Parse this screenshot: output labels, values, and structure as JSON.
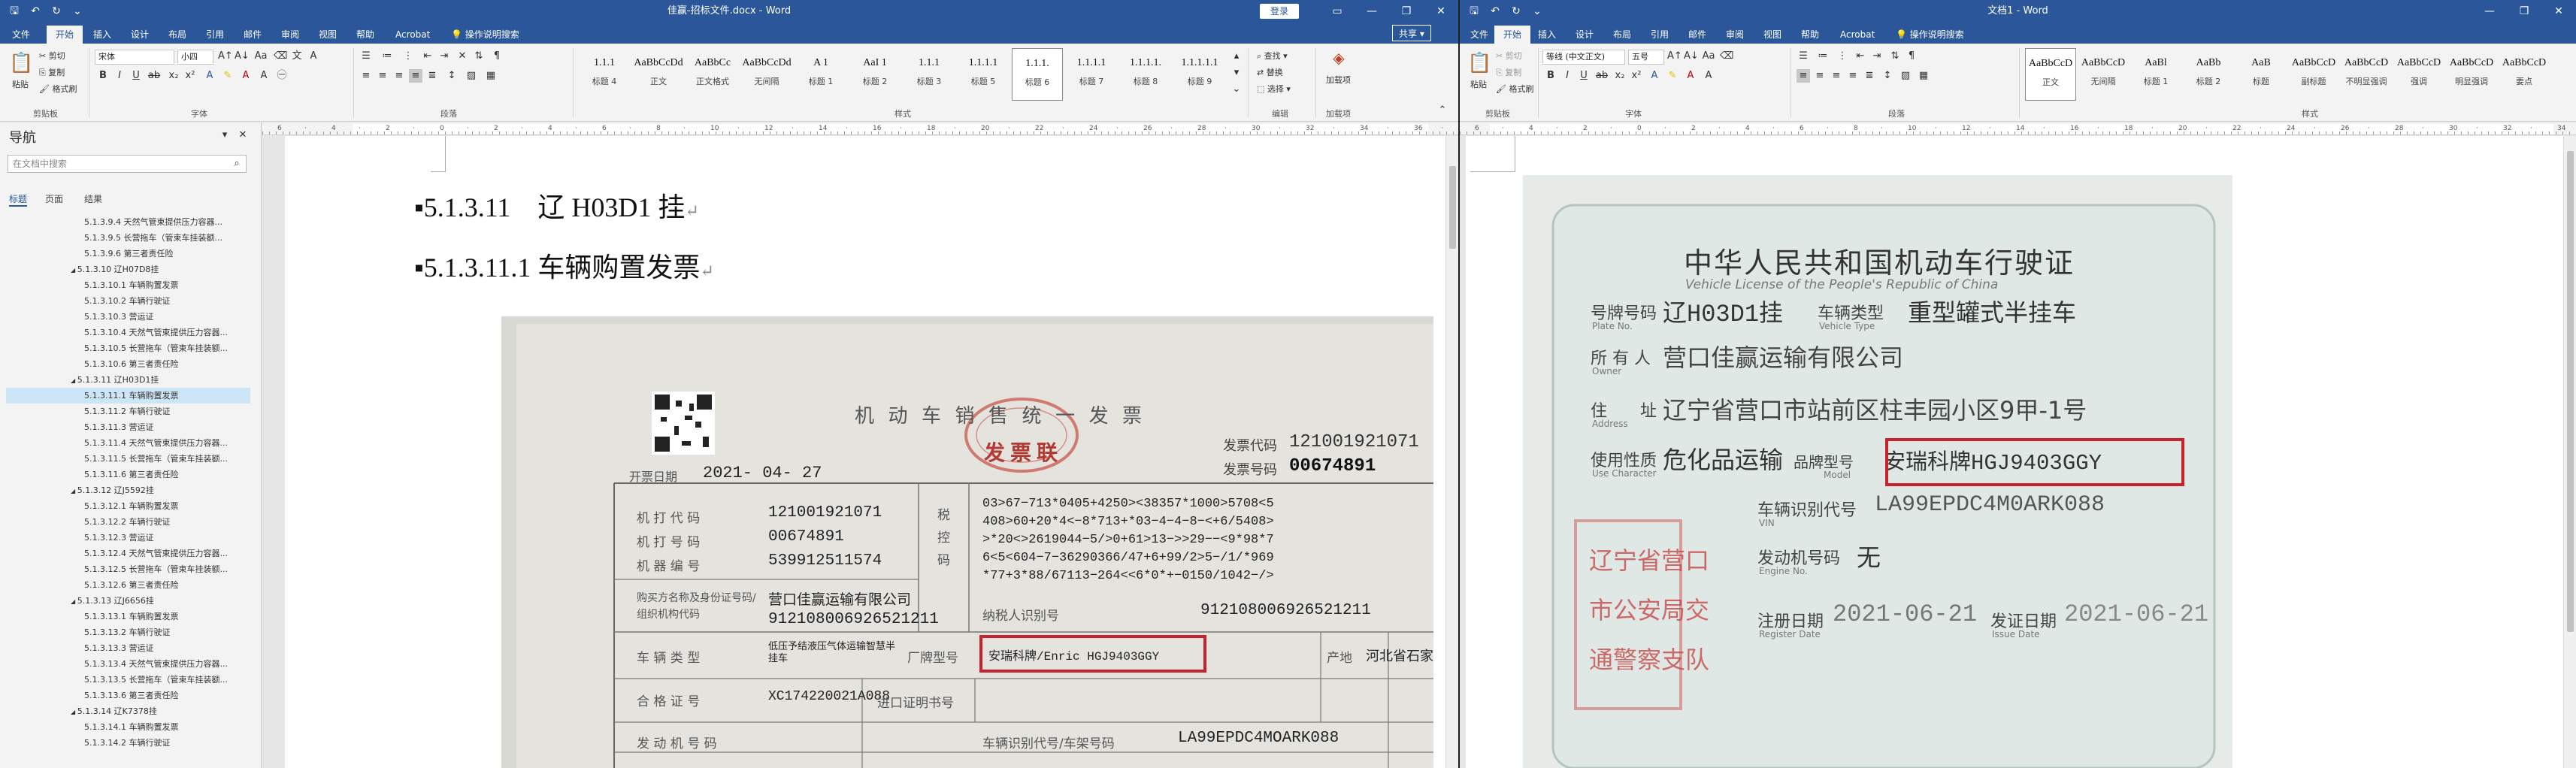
{
  "left": {
    "title": "佳赢-招标文件.docx - Word",
    "login_label": "登录",
    "share_label": "共享",
    "tabs": [
      "文件",
      "开始",
      "插入",
      "设计",
      "布局",
      "引用",
      "邮件",
      "审阅",
      "视图",
      "帮助",
      "Acrobat"
    ],
    "tell_me": "操作说明搜索",
    "clipboard": {
      "paste": "粘贴",
      "cut": "剪切",
      "copy": "复制",
      "format_painter": "格式刷",
      "label": "剪贴板"
    },
    "font": {
      "name": "宋体",
      "size": "小四",
      "label": "字体"
    },
    "paragraph_label": "段落",
    "styles": [
      {
        "preview": "1.1.1",
        "name": "标题 4"
      },
      {
        "preview": "AaBbCcDd",
        "name": "正文"
      },
      {
        "preview": "AaBbCc",
        "name": "正文格式"
      },
      {
        "preview": "AaBbCcDd",
        "name": "无间隔"
      },
      {
        "preview": "A 1",
        "name": "标题 1"
      },
      {
        "preview": "AaI 1",
        "name": "标题 2"
      },
      {
        "preview": "1.1.1",
        "name": "标题 3"
      },
      {
        "preview": "1.1.1.1",
        "name": "标题 5"
      },
      {
        "preview": "1.1.1.",
        "name": "标题 6"
      },
      {
        "preview": "1.1.1.1",
        "name": "标题 7"
      },
      {
        "preview": "1.1.1.1.",
        "name": "标题 8"
      },
      {
        "preview": "1.1.1.1.1",
        "name": "标题 9"
      }
    ],
    "styles_label": "样式",
    "editing": {
      "find": "查找",
      "replace": "替换",
      "select": "选择",
      "label": "编辑"
    },
    "addins": {
      "load": "加载项",
      "label": "加载项"
    },
    "nav": {
      "title": "导航",
      "search_placeholder": "在文档中搜索",
      "tabs": [
        "标题",
        "页面",
        "结果"
      ],
      "items": [
        "5.1.3.9.4 天然气管束提供压力容器...",
        "5.1.3.9.5 长营拖车（管束车挂装额...",
        "5.1.3.9.6 第三者责任险",
        "5.1.3.10 辽H07D8挂",
        "5.1.3.10.1 车辆购置发票",
        "5.1.3.10.2 车辆行驶证",
        "5.1.3.10.3 营运证",
        "5.1.3.10.4 天然气管束提供压力容器...",
        "5.1.3.10.5 长营拖车（管束车挂装额...",
        "5.1.3.10.6 第三者责任险",
        "5.1.3.11 辽H03D1挂",
        "5.1.3.11.1 车辆购置发票",
        "5.1.3.11.2 车辆行驶证",
        "5.1.3.11.3 营运证",
        "5.1.3.11.4 天然气管束提供压力容器...",
        "5.1.3.11.5 长营拖车（管束车挂装额...",
        "5.1.3.11.6 第三者责任险",
        "5.1.3.12 辽J5592挂",
        "5.1.3.12.1 车辆购置发票",
        "5.1.3.12.2 车辆行驶证",
        "5.1.3.12.3 营运证",
        "5.1.3.12.4 天然气管束提供压力容器...",
        "5.1.3.12.5 长营拖车（管束车挂装额...",
        "5.1.3.12.6 第三者责任险",
        "5.1.3.13 辽J6656挂",
        "5.1.3.13.1 车辆购置发票",
        "5.1.3.13.2 车辆行驶证",
        "5.1.3.13.3 营运证",
        "5.1.3.13.4 天然气管束提供压力容器...",
        "5.1.3.13.5 长营拖车（管束车挂装额...",
        "5.1.3.13.6 第三者责任险",
        "5.1.3.14 辽K7378挂",
        "5.1.3.14.1 车辆购置发票",
        "5.1.3.14.2 车辆行驶证"
      ]
    },
    "doc": {
      "heading1": "▪5.1.3.11　辽 H03D1 挂",
      "heading2": "▪5.1.3.11.1 车辆购置发票",
      "mark": "↵"
    },
    "invoice": {
      "title": "机 动 车 销 售 统 一 发 票",
      "stamp_word": "发 票 联",
      "issue_date_label": "开票日期",
      "issue_date": "2021- 04- 27",
      "code_label": "发票代码",
      "code": "121001921071",
      "number_label": "发票号码",
      "number": "00674891",
      "machine_code_label": "机 打 代 码",
      "machine_code": "121001921071",
      "machine_no_label": "机 打 号 码",
      "machine_no": "00674891",
      "machine_id_label": "机 器 编 号",
      "machine_id": "539912511574",
      "tax_label": "税 控 码",
      "tax_lines": [
        "03>67−713*0405+4250><38357*1000>5708<5",
        "408>60+20*4<−8*713+*03−4−4−8−<+6/5408>",
        ">*20<>2619044−5/>0+61>13−>>29−−<9*98*7",
        "6<5<604−7−36290366/47+6+99/2>5−/1/*969",
        "*77+3*88/67113−264<<6*0*+−0150/1042−/>"
      ],
      "buyer_label": "购买方名称及身份证号码/组织机构代码",
      "buyer_name": "营口佳赢运输有限公司",
      "buyer_id": "912108006926521211",
      "taxpayer_label": "纳税人识别号",
      "taxpayer_id": "912108006926521211",
      "vehicle_type_label": "车 辆 类 型",
      "vehicle_type": "低压予结液压气体运输智慧半挂车",
      "model_label": "厂牌型号",
      "model": "安瑞科牌/Enric HGJ9403GGY",
      "origin_label": "产地",
      "origin": "河北省石家庄",
      "cert_label": "合 格 证 号",
      "cert": "XC174220021A088",
      "import_label": "进口证明书号",
      "engine_label": "发 动 机 号 码",
      "vin_label": "车辆识别代号/车架号码",
      "vin": "LA99EPDC4MOARK088"
    }
  },
  "right": {
    "title": "文档1 - Word",
    "tabs": [
      "文件",
      "开始",
      "插入",
      "设计",
      "布局",
      "引用",
      "邮件",
      "审阅",
      "视图",
      "帮助",
      "Acrobat"
    ],
    "tell_me": "操作说明搜索",
    "clipboard": {
      "paste": "粘贴",
      "cut": "剪切",
      "copy": "复制",
      "format_painter": "格式刷",
      "label": "剪贴板"
    },
    "font": {
      "name": "等线 (中文正文)",
      "size": "五号",
      "label": "字体"
    },
    "paragraph_label": "段落",
    "styles": [
      {
        "preview": "AaBbCcD",
        "name": "正文"
      },
      {
        "preview": "AaBbCcD",
        "name": "无间隔"
      },
      {
        "preview": "AaBl",
        "name": "标题 1"
      },
      {
        "preview": "AaBb",
        "name": "标题 2"
      },
      {
        "preview": "AaB",
        "name": "标题"
      },
      {
        "preview": "AaBbCcD",
        "name": "副标题"
      },
      {
        "preview": "AaBbCcD",
        "name": "不明显强调"
      },
      {
        "preview": "AaBbCcD",
        "name": "强调"
      },
      {
        "preview": "AaBbCcD",
        "name": "明显强调"
      },
      {
        "preview": "AaBbCcD",
        "name": "要点"
      }
    ],
    "styles_label": "样式",
    "license": {
      "title": "中华人民共和国机动车行驶证",
      "title_en": "Vehicle License of the People's Republic of China",
      "plate_label": "号牌号码",
      "plate": "辽H03D1挂",
      "type_label": "车辆类型",
      "type": "重型罐式半挂车",
      "owner_label": "所 有 人",
      "owner": "营口佳赢运输有限公司",
      "address_label": "住　　址",
      "address": "辽宁省营口市站前区柱丰园小区9甲-1号",
      "use_label": "使用性质",
      "use": "危化品运输",
      "model_label": "品牌型号",
      "model": "安瑞科牌HGJ9403GGY",
      "vin_label": "车辆识别代号",
      "vin": "LA99EPDC4M0ARK088",
      "engine_label": "发动机号码",
      "engine": "无",
      "reg_label": "注册日期",
      "reg": "2021-06-21",
      "issue_label": "发证日期",
      "issue": "2021-06-21",
      "seal_lines": [
        "辽宁省营口",
        "市公安局交",
        "通警察支队"
      ],
      "en_plate": "Plate No.",
      "en_type": "Vehicle Type",
      "en_owner": "Owner",
      "en_address": "Address",
      "en_use": "Use Character",
      "en_model": "Model",
      "en_vin": "VIN",
      "en_engine": "Engine No.",
      "en_reg": "Register Date",
      "en_issue": "Issue Date"
    }
  },
  "colors": {
    "word_blue": "#2b579a",
    "highlight_red": "#c8232c",
    "nav_select": "#cde6f7"
  }
}
